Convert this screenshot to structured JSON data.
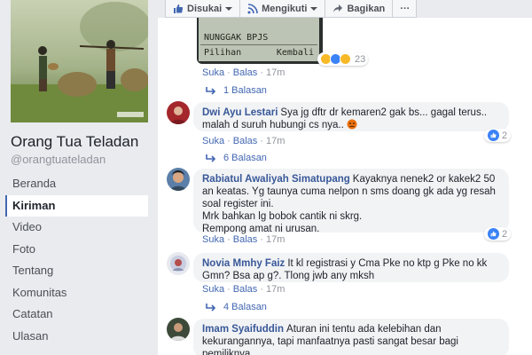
{
  "page": {
    "name": "Orang Tua Teladan",
    "handle": "@orangtuateladan"
  },
  "nav": {
    "items": [
      {
        "label": "Beranda",
        "active": false
      },
      {
        "label": "Kiriman",
        "active": true
      },
      {
        "label": "Video",
        "active": false
      },
      {
        "label": "Foto",
        "active": false
      },
      {
        "label": "Tentang",
        "active": false
      },
      {
        "label": "Komunitas",
        "active": false
      },
      {
        "label": "Catatan",
        "active": false
      },
      {
        "label": "Ulasan",
        "active": false
      }
    ]
  },
  "actions": {
    "like": "Disukai",
    "follow": "Mengikuti",
    "share": "Bagikan",
    "more": "···"
  },
  "phone": {
    "line1": "NUNGGAK BPJS",
    "left": "Pilihan",
    "right": "Kembali"
  },
  "comments": [
    {
      "author": "",
      "text": "",
      "like": "Suka",
      "reply": "Balas",
      "time": "17m",
      "reactions_count": "23",
      "replies": "1 Balasan"
    },
    {
      "author": "Dwi Ayu Lestari",
      "text": "Sya jg dftr dr kemaren2 gak bs... gagal terus.. malah d suruh hubungi cs nya..",
      "like": "Suka",
      "reply": "Balas",
      "time": "17m",
      "reactions_count": "2",
      "replies": "6 Balasan"
    },
    {
      "author": "Rabiatul Awaliyah Simatupang",
      "text": "Kayaknya nenek2 or kakek2 50 an keatas. Yg taunya cuma nelpon n sms doang gk ada yg resah soal register ini.",
      "text2": "Mrk bahkan lg bobok cantik ni skrg.",
      "text3": "Rempong amat ni urusan.",
      "like": "Suka",
      "reply": "Balas",
      "time": "17m",
      "reactions_count": "2",
      "replies": ""
    },
    {
      "author": "Novia Mmhy Faiz",
      "text": "It kl registrasi y Cma Pke no ktp g Pke no kk Gmn? Bsa ap g?. Tlong jwb any mksh",
      "like": "Suka",
      "reply": "Balas",
      "time": "17m",
      "reactions_count": "",
      "replies": "4 Balasan"
    },
    {
      "author": "Imam Syaifuddin",
      "text": "Aturan ini tentu ada kelebihan dan kekurangannya, tapi manfaatnya pasti sangat besar bagi pemiliknya.",
      "like": "",
      "reply": "",
      "time": "",
      "reactions_count": "",
      "replies": ""
    }
  ],
  "colors": {
    "link": "#385898",
    "accent": "#4267b2",
    "bubble": "#f2f3f5",
    "page_bg": "#e9ebee"
  }
}
